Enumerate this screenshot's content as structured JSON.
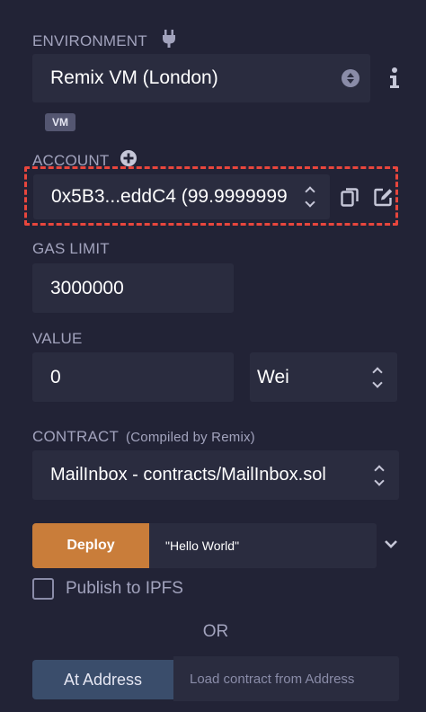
{
  "environment": {
    "label": "ENVIRONMENT",
    "plug_icon": "plug-icon",
    "selected": "Remix VM (London)",
    "info_icon": "info-icon",
    "badge": "VM"
  },
  "account": {
    "label": "ACCOUNT",
    "add_icon": "plus-circle-icon",
    "selected": "0x5B3...eddC4 (99.9999999",
    "copy_icon": "copy-icon",
    "edit_icon": "edit-icon",
    "highlight_color": "#e8463d"
  },
  "gas_limit": {
    "label": "GAS LIMIT",
    "value": "3000000"
  },
  "value": {
    "label": "VALUE",
    "amount": "0",
    "unit": "Wei"
  },
  "contract": {
    "label": "CONTRACT",
    "sublabel": "(Compiled by Remix)",
    "selected": "MailInbox - contracts/MailInbox.sol"
  },
  "deploy": {
    "button_label": "Deploy",
    "args_value": "\"Hello World\"",
    "expand_icon": "chevron-down-icon",
    "accent": "#c97d3a"
  },
  "publish": {
    "label": "Publish to IPFS",
    "checked": false
  },
  "or_label": "OR",
  "at_address": {
    "button_label": "At Address",
    "placeholder": "Load contract from Address"
  }
}
